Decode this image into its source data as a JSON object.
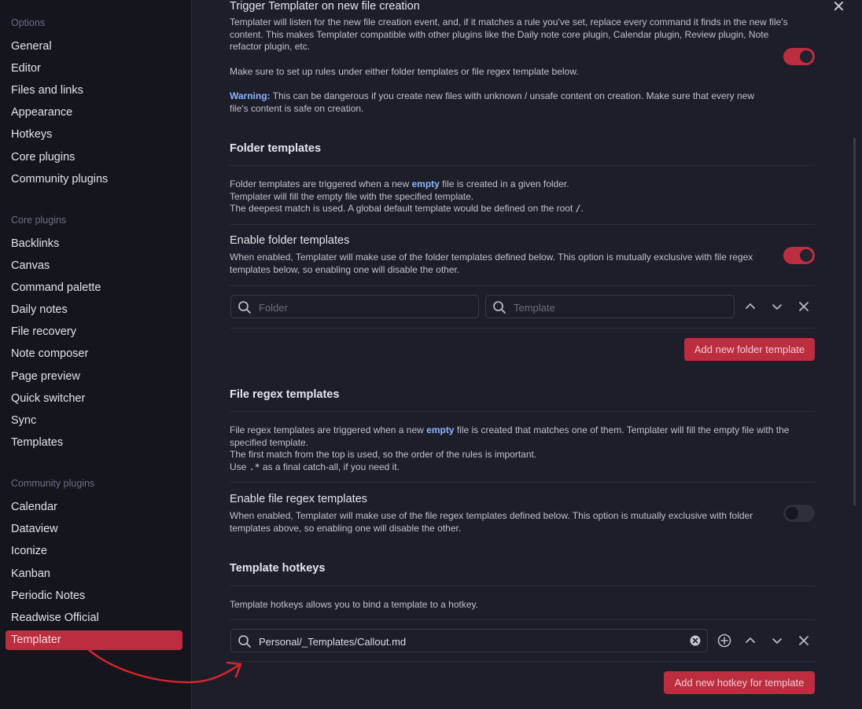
{
  "sidebar": {
    "options_heading": "Options",
    "options": [
      "General",
      "Editor",
      "Files and links",
      "Appearance",
      "Hotkeys",
      "Core plugins",
      "Community plugins"
    ],
    "core_heading": "Core plugins",
    "core": [
      "Backlinks",
      "Canvas",
      "Command palette",
      "Daily notes",
      "File recovery",
      "Note composer",
      "Page preview",
      "Quick switcher",
      "Sync",
      "Templates"
    ],
    "community_heading": "Community plugins",
    "community": [
      "Calendar",
      "Dataview",
      "Iconize",
      "Kanban",
      "Periodic Notes",
      "Readwise Official",
      "Templater"
    ]
  },
  "trigger": {
    "name": "Trigger Templater on new file creation",
    "desc1": "Templater will listen for the new file creation event, and, if it matches a rule you've set, replace every command it finds in the new file's content. This makes Templater compatible with other plugins like the Daily note core plugin, Calendar plugin, Review plugin, Note refactor plugin, etc.",
    "desc2": "Make sure to set up rules under either folder templates or file regex template below.",
    "warning_label": "Warning:",
    "warning_text": " This can be dangerous if you create new files with unknown / unsafe content on creation. Make sure that every new file's content is safe on creation.",
    "enabled": true
  },
  "folder_templates": {
    "heading": "Folder templates",
    "desc_a": "Folder templates are triggered when a new ",
    "desc_empty": "empty",
    "desc_b": " file is created in a given folder.",
    "desc2": "Templater will fill the empty file with the specified template.",
    "desc3": "The deepest match is used. A global default template would be defined on the root ",
    "root_code": "/",
    "desc3_end": ".",
    "enable_name": "Enable folder templates",
    "enable_desc": "When enabled, Templater will make use of the folder templates defined below. This option is mutually exclusive with file regex templates below, so enabling one will disable the other.",
    "enabled": true,
    "folder_placeholder": "Folder",
    "template_placeholder": "Template",
    "add_button": "Add new folder template"
  },
  "regex_templates": {
    "heading": "File regex templates",
    "desc_a": "File regex templates are triggered when a new ",
    "desc_empty": "empty",
    "desc_b": " file is created that matches one of them. Templater will fill the empty file with the specified template.",
    "desc2": "The first match from the top is used, so the order of the rules is important.",
    "desc3_a": "Use ",
    "catchall_code": ".*",
    "desc3_b": " as a final catch-all, if you need it.",
    "enable_name": "Enable file regex templates",
    "enable_desc": "When enabled, Templater will make use of the file regex templates defined below. This option is mutually exclusive with folder templates above, so enabling one will disable the other.",
    "enabled": false
  },
  "hotkeys": {
    "heading": "Template hotkeys",
    "desc": "Template hotkeys allows you to bind a template to a hotkey.",
    "template_value": "Personal/_Templates/Callout.md",
    "add_button": "Add new hotkey for template"
  },
  "colors": {
    "accent": "#bd2d40",
    "link_blue": "#8ab4ff",
    "annotation_arrow": "#d6242c"
  }
}
